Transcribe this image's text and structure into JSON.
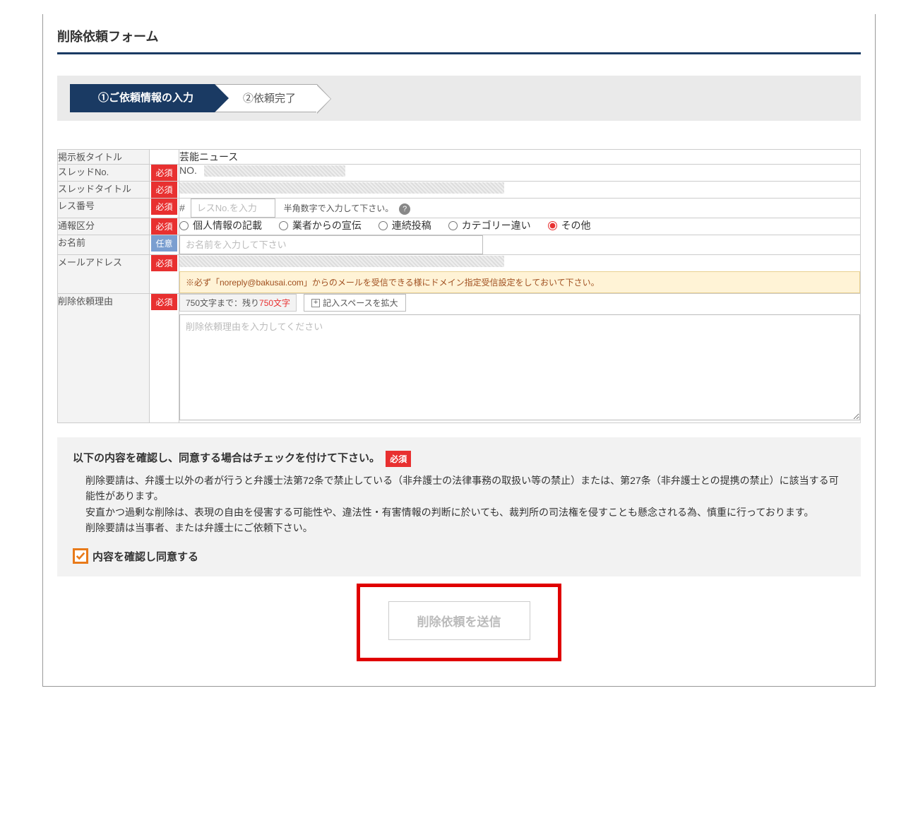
{
  "page": {
    "title": "削除依頼フォーム"
  },
  "steps": {
    "step1": "①ご依頼情報の入力",
    "step2": "②依頼完了"
  },
  "badges": {
    "required": "必須",
    "optional": "任意"
  },
  "fields": {
    "board_title": {
      "label": "掲示板タイトル",
      "value": "芸能ニュース"
    },
    "thread_no": {
      "label": "スレッドNo.",
      "prefix": "NO."
    },
    "thread_title": {
      "label": "スレッドタイトル"
    },
    "res_no": {
      "label": "レス番号",
      "hash": "#",
      "placeholder": "レスNo.を入力",
      "hint": "半角数字で入力して下さい。"
    },
    "report_type": {
      "label": "通報区分",
      "options": {
        "o1": "個人情報の記載",
        "o2": "業者からの宣伝",
        "o3": "連続投稿",
        "o4": "カテゴリー違い",
        "o5": "その他"
      }
    },
    "name": {
      "label": "お名前",
      "placeholder": "お名前を入力して下さい"
    },
    "email": {
      "label": "メールアドレス",
      "notice": "※必ず「noreply@bakusai.com」からのメールを受信できる様にドメイン指定受信設定をしておいて下さい。"
    },
    "reason": {
      "label": "削除依頼理由",
      "counter_prefix": "750文字まで：残り",
      "counter_count": "750文字",
      "expand": "記入スペースを拡大",
      "placeholder": "削除依頼理由を入力してください"
    }
  },
  "agree": {
    "heading": "以下の内容を確認し、同意する場合はチェックを付けて下さい。",
    "text": "削除要請は、弁護士以外の者が行うと弁護士法第72条で禁止している（非弁護士の法律事務の取扱い等の禁止）または、第27条（非弁護士との提携の禁止）に該当する可能性があります。\n安直かつ過剰な削除は、表現の自由を侵害する可能性や、違法性・有害情報の判断に於いても、裁判所の司法権を侵すことも懸念される為、慎重に行っております。\n削除要請は当事者、または弁護士にご依頼下さい。",
    "checkbox_label": "内容を確認し同意する"
  },
  "submit": {
    "label": "削除依頼を送信"
  }
}
